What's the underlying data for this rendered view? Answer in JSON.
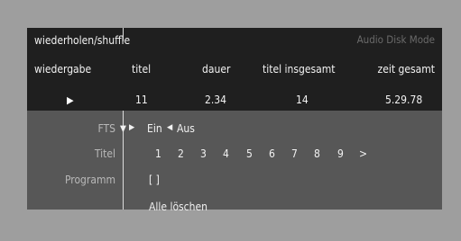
{
  "header": {
    "title": "wiederholen/shuffle",
    "mode": "Audio Disk Mode"
  },
  "columns": {
    "playback": "wiedergabe",
    "track": "titel",
    "duration": "dauer",
    "total_tracks": "titel insgesamt",
    "total_time": "zeit gesamt"
  },
  "values": {
    "play_icon": "play-icon",
    "track": "11",
    "duration": "2.34",
    "total_tracks": "14",
    "total_time": "5.29.78"
  },
  "rows": {
    "fts_label": "FTS",
    "fts_on": "Ein",
    "fts_off": "Aus",
    "track_label": "Titel",
    "track_numbers": [
      "1",
      "2",
      "3",
      "4",
      "5",
      "6",
      "7",
      "8",
      "9"
    ],
    "track_next": ">",
    "program_label": "Programm",
    "program_value": "[ ]",
    "clear_all": "Alle löschen"
  }
}
